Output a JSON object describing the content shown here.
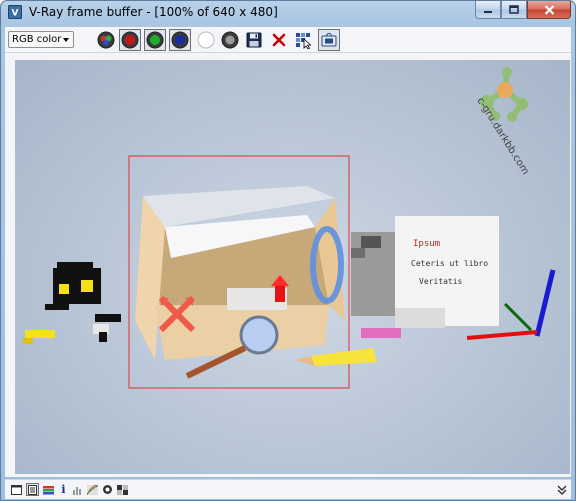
{
  "window": {
    "title": "V-Ray frame buffer - [100% of 640 x 480]"
  },
  "toolbar": {
    "channel_select": "RGB color",
    "buttons": [
      {
        "name": "rgb-channels-button",
        "icon": "rgb-circle-icon"
      },
      {
        "name": "red-channel-button",
        "icon": "red-circle-icon",
        "color": "#c41818"
      },
      {
        "name": "green-channel-button",
        "icon": "green-circle-icon",
        "color": "#1fae2a"
      },
      {
        "name": "blue-channel-button",
        "icon": "blue-circle-icon",
        "color": "#1a2aa0"
      },
      {
        "name": "alpha-channel-button",
        "icon": "white-circle-icon",
        "color": "#ffffff"
      },
      {
        "name": "monochrome-button",
        "icon": "gray-circle-icon"
      },
      {
        "name": "save-image-button",
        "icon": "floppy-disk-icon"
      },
      {
        "name": "clear-image-button",
        "icon": "red-x-icon",
        "color": "#d00000"
      },
      {
        "name": "duplicate-to-max-vfb-button",
        "icon": "pixel-cursor-icon"
      },
      {
        "name": "track-mouse-button",
        "icon": "render-region-icon"
      }
    ]
  },
  "render": {
    "watermark_text": "c-gru.darkbb.com",
    "paper_text": [
      "Ipsum",
      "Ceteris ut libro",
      "Veritatis"
    ],
    "region_color": "#e03030"
  },
  "statusbar": {
    "info_label": "i",
    "icons": [
      "frame-icon",
      "history-icon",
      "color-correction-icon",
      "info-icon",
      "levels-icon",
      "curves-icon",
      "lens-icon",
      "lut-icon",
      "expand-icon"
    ]
  }
}
